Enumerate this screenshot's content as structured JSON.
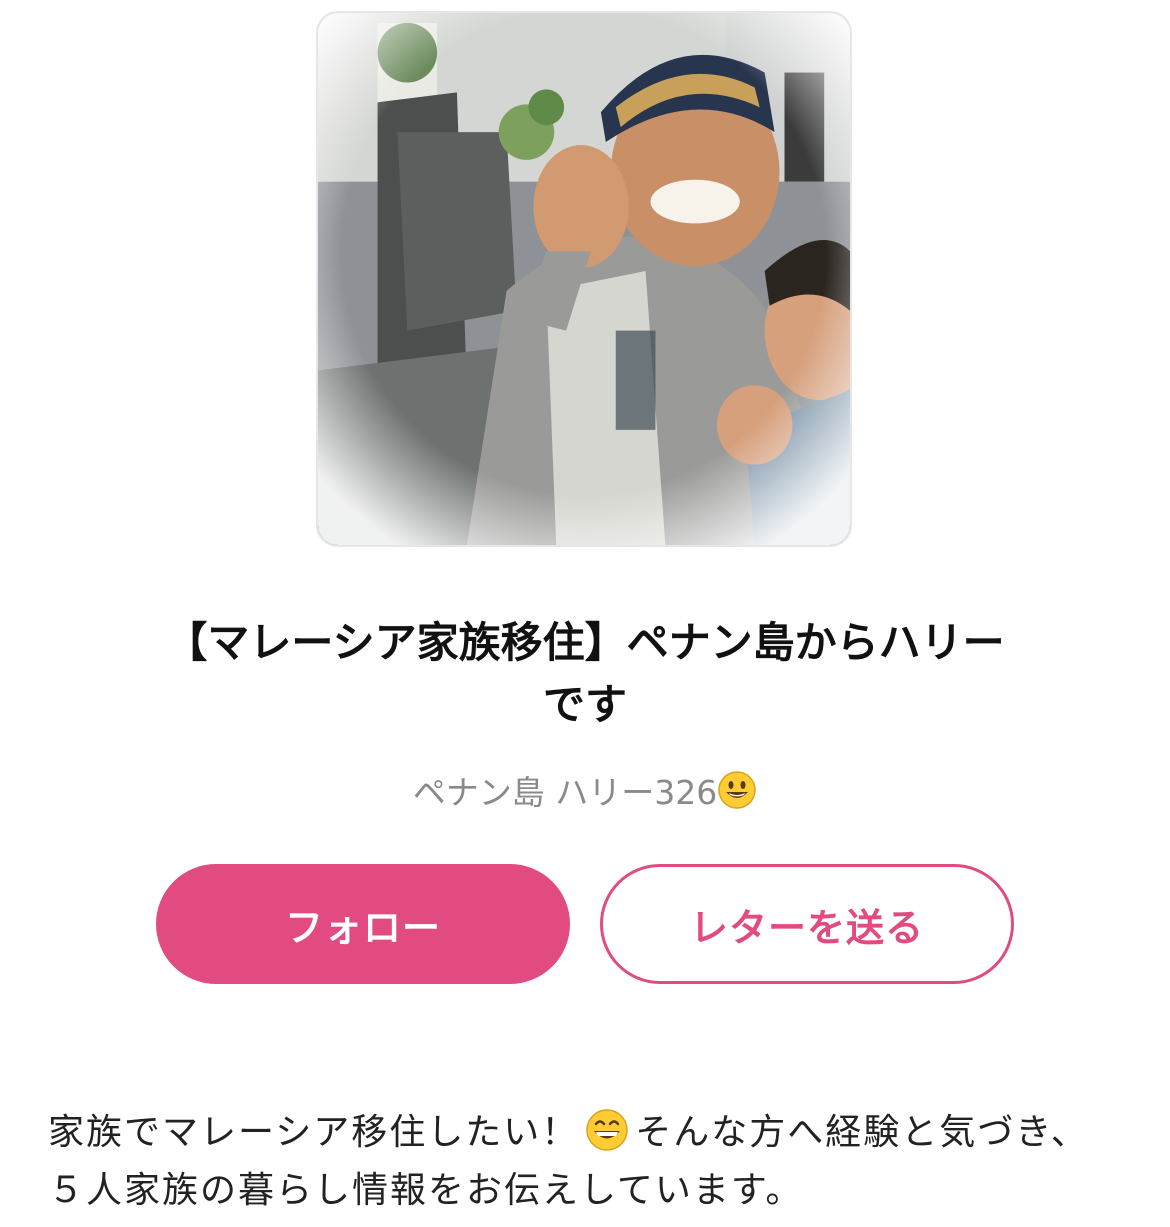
{
  "profile": {
    "blog_title": "【マレーシア家族移住】ペナン島からハリーです",
    "author_name": "ペナン島 ハリー326",
    "author_emoji_icon": "smiley-icon",
    "avatar_alt": "avatar photo"
  },
  "actions": {
    "follow_label": "フォロー",
    "letter_label": "レターを送る"
  },
  "bio": {
    "part1": "家族でマレーシア移住したい！",
    "emoji_icon": "grinning-face-icon",
    "part2": "そんな方へ経験と気づき、５人家族の暮らし情報をお伝えしています。"
  },
  "colors": {
    "accent": "#e14b82",
    "author_text": "#8a8a8a",
    "title_text": "#111111"
  }
}
